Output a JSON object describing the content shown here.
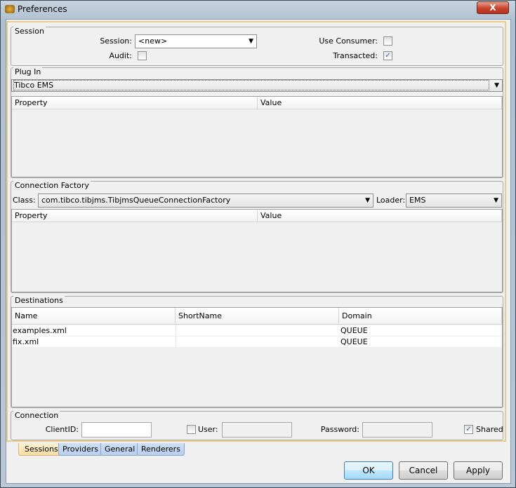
{
  "window": {
    "title": "Preferences",
    "close_label": "X"
  },
  "session": {
    "title": "Session",
    "session_label": "Session:",
    "session_value": "<new>",
    "use_consumer_label": "Use Consumer:",
    "use_consumer_checked": false,
    "audit_label": "Audit:",
    "audit_checked": false,
    "transacted_label": "Transacted:",
    "transacted_checked": true
  },
  "plugin": {
    "title": "Plug In",
    "selected": "Tibco EMS",
    "columns": [
      "Property",
      "Value"
    ]
  },
  "connection_factory": {
    "title": "Connection Factory",
    "class_label": "Class:",
    "class_value": "com.tibco.tibjms.TibjmsQueueConnectionFactory",
    "loader_label": "Loader:",
    "loader_value": "EMS",
    "columns": [
      "Property",
      "Value"
    ]
  },
  "destinations": {
    "title": "Destinations",
    "columns": [
      "Name",
      "ShortName",
      "Domain"
    ],
    "rows": [
      {
        "name": "examples.xml",
        "short": "",
        "domain": "QUEUE"
      },
      {
        "name": "fix.xml",
        "short": "",
        "domain": "QUEUE"
      }
    ]
  },
  "connection": {
    "title": "Connection",
    "clientid_label": "ClientID:",
    "clientid_value": "",
    "user_label": "User:",
    "user_checked": false,
    "password_label": "Password:",
    "shared_label": "Shared",
    "shared_checked": true
  },
  "tabs": [
    {
      "label": "Sessions",
      "active": true
    },
    {
      "label": "Providers"
    },
    {
      "label": "General"
    },
    {
      "label": "Renderers"
    }
  ],
  "buttons": {
    "ok": "OK",
    "cancel": "Cancel",
    "apply": "Apply"
  }
}
